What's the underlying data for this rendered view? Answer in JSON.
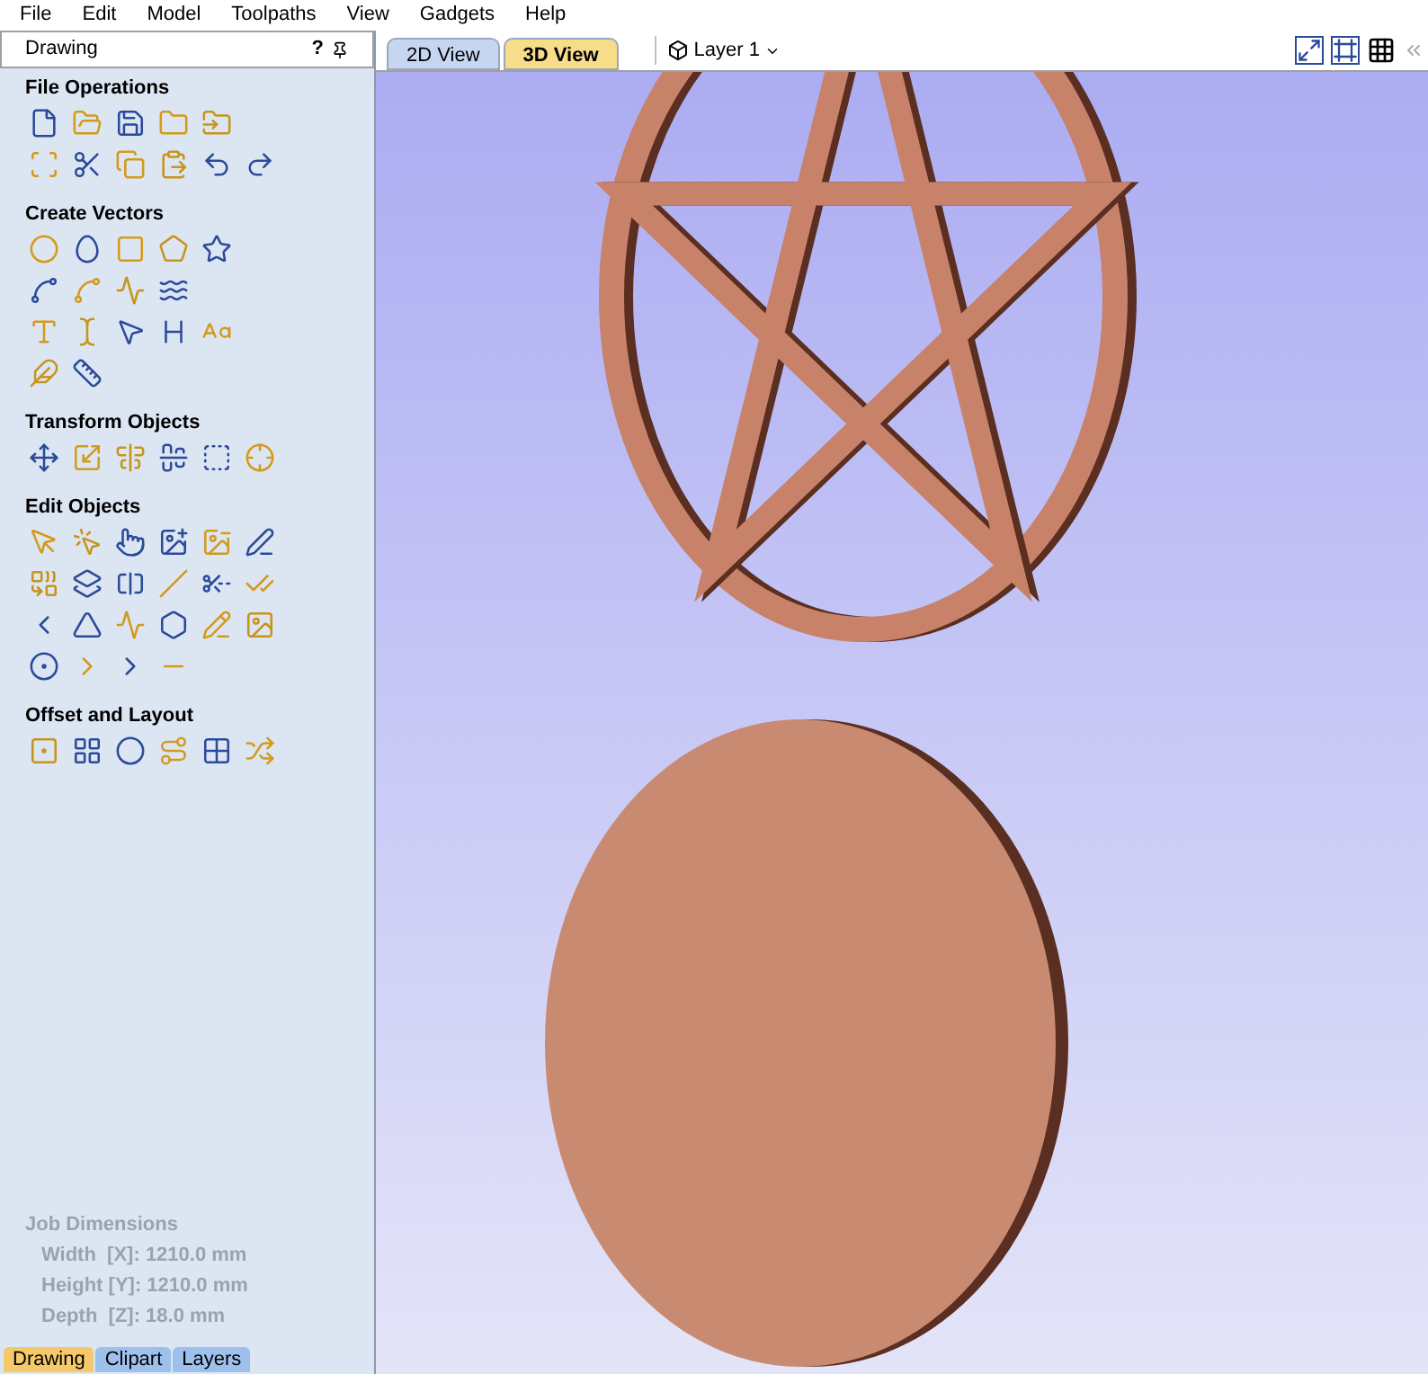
{
  "menu": [
    "File",
    "Edit",
    "Model",
    "Toolpaths",
    "View",
    "Gadgets",
    "Help"
  ],
  "panel": {
    "title": "Drawing",
    "help": "?",
    "sections": [
      {
        "title": "File Operations"
      },
      {
        "title": "Create Vectors"
      },
      {
        "title": "Transform Objects"
      },
      {
        "title": "Edit Objects"
      },
      {
        "title": "Offset and Layout"
      }
    ],
    "job_dimensions": {
      "title": "Job Dimensions",
      "disabled": true,
      "rows": [
        "Width  [X]: 1210.0 mm",
        "Height [Y]: 1210.0 mm",
        "Depth  [Z]: 18.0 mm"
      ]
    },
    "bottom_tabs": [
      {
        "label": "Drawing",
        "selected": true
      },
      {
        "label": "Clipart",
        "selected": false
      },
      {
        "label": "Layers",
        "selected": false
      }
    ]
  },
  "view_tabs": [
    {
      "label": "2D View",
      "selected": false
    },
    {
      "label": "3D View",
      "selected": true
    }
  ],
  "layer_dropdown": {
    "value": "Layer 1"
  }
}
